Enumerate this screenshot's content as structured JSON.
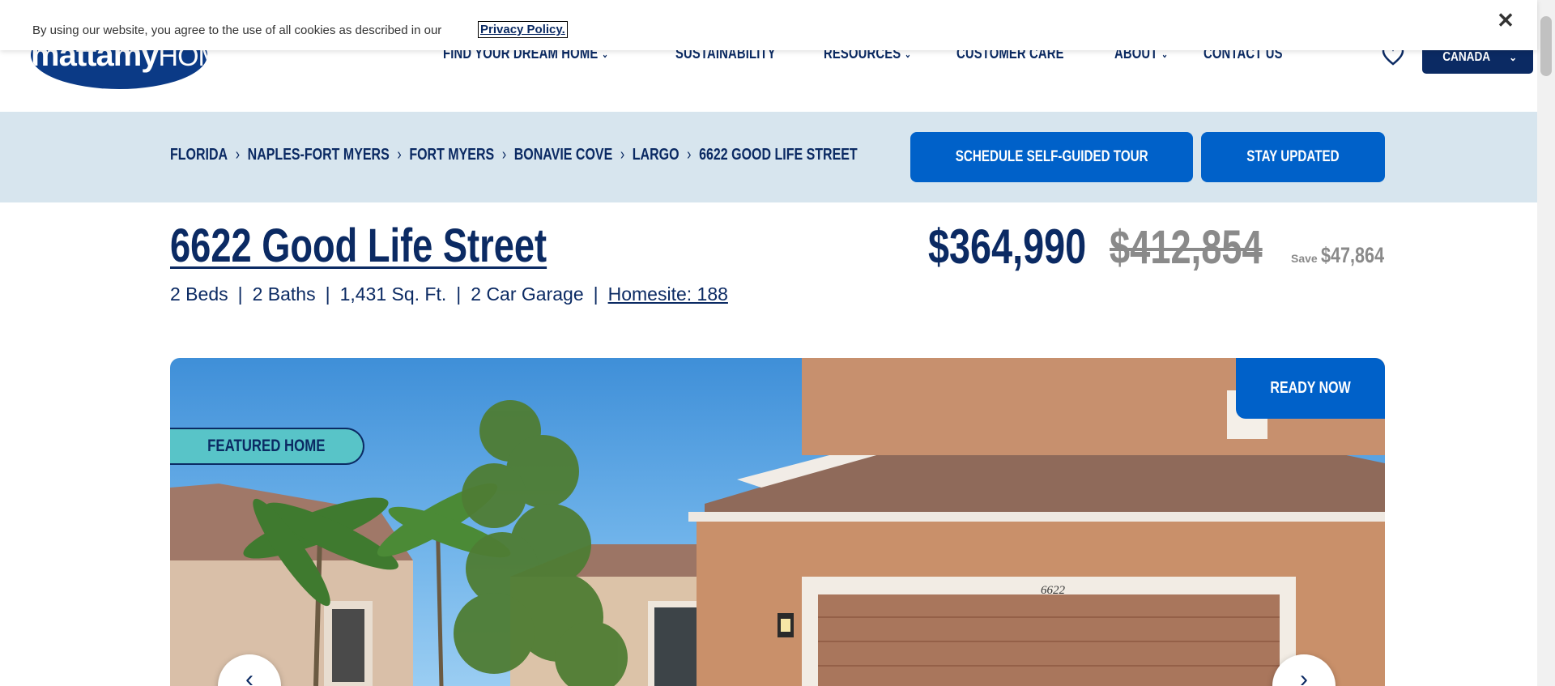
{
  "cookie": {
    "text": "By using our website, you agree to the use of all cookies as described in our",
    "link": "Privacy Policy."
  },
  "header": {
    "logo_main": "mattamy",
    "logo_thin": "HOMES",
    "nav": [
      {
        "label": "FIND YOUR DREAM HOME",
        "dropdown": true
      },
      {
        "label": "SUSTAINABILITY",
        "dropdown": false
      },
      {
        "label": "RESOURCES",
        "dropdown": true
      },
      {
        "label": "CUSTOMER CARE",
        "dropdown": false
      },
      {
        "label": "ABOUT",
        "dropdown": true
      },
      {
        "label": "CONTACT US",
        "dropdown": false
      }
    ],
    "country": "CANADA"
  },
  "breadcrumb": [
    "FLORIDA",
    "NAPLES-FORT MYERS",
    "FORT MYERS",
    "BONAVIE COVE",
    "LARGO",
    "6622 GOOD LIFE STREET"
  ],
  "actions": {
    "tour": "SCHEDULE SELF-GUIDED TOUR",
    "updated": "STAY UPDATED"
  },
  "listing": {
    "address": "6622 Good Life Street",
    "beds": "2 Beds",
    "baths": "2 Baths",
    "sqft": "1,431 Sq. Ft.",
    "garage": "2 Car Garage",
    "homesite": "Homesite: 188",
    "separator": "|",
    "price": "$364,990",
    "old_price": "$412,854",
    "save_label": "Save",
    "save_value": "$47,864"
  },
  "hero": {
    "status": "READY NOW",
    "featured": "FEATURED HOME",
    "house_number": "6622"
  },
  "colors": {
    "navy": "#0b2a63",
    "blue": "#0061c9",
    "band": "#d7e5ee",
    "teal": "#58c4c8"
  }
}
